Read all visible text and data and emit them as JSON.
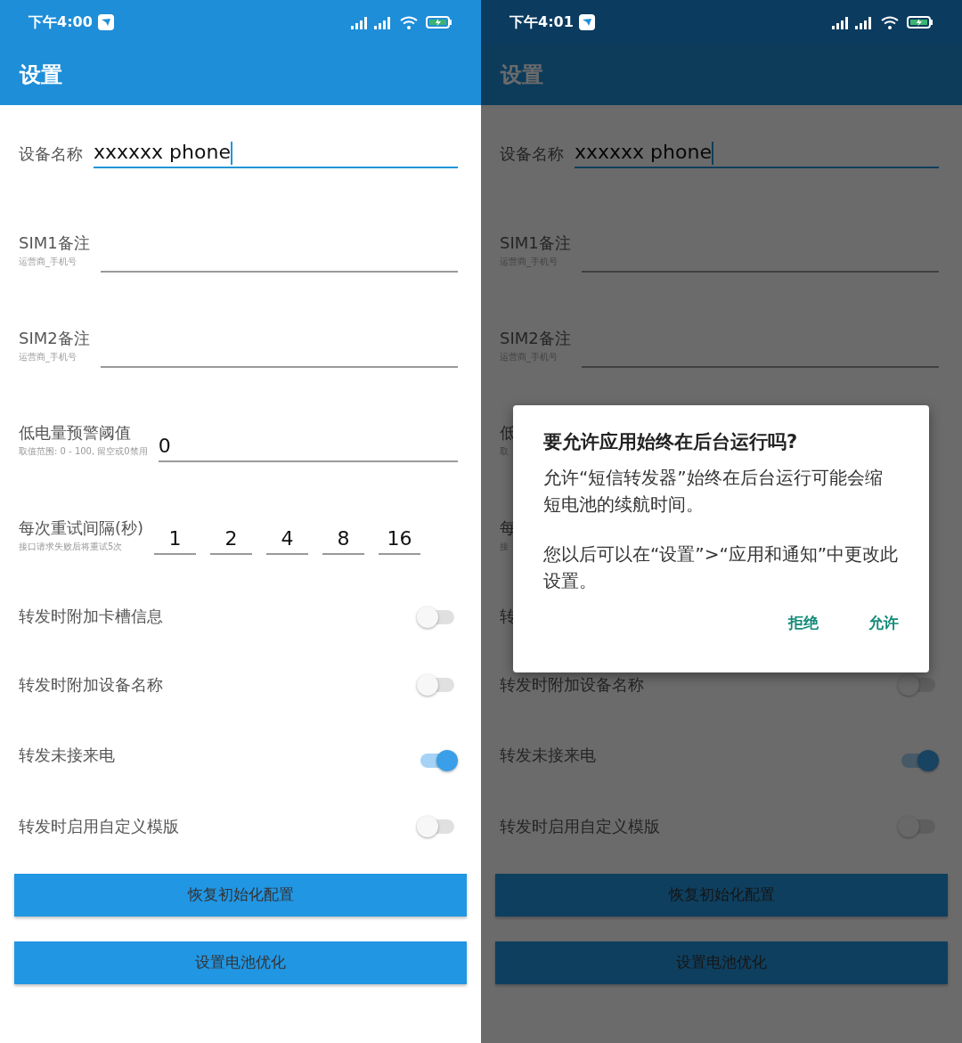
{
  "screens": [
    {
      "status_time": "下午4:00",
      "title": "设置",
      "dimmed": false,
      "rows": [
        {
          "kind": "text_field",
          "label": "设备名称",
          "value": "xxxxxx phone",
          "focused": true
        },
        {
          "kind": "text_field",
          "label": "SIM1备注",
          "hint": "运营商_手机号"
        },
        {
          "kind": "text_field",
          "label": "SIM2备注",
          "hint": "运营商_手机号"
        },
        {
          "kind": "text_field",
          "label": "低电量预警阈值",
          "hint": "取值范围: 0 - 100, 留空或0禁用",
          "value": "0"
        },
        {
          "kind": "retry",
          "label": "每次重试间隔(秒)",
          "hint": "接口请求失败后将重试5次",
          "values": [
            "1",
            "2",
            "4",
            "8",
            "16"
          ]
        },
        {
          "kind": "switch",
          "label": "转发时附加卡槽信息",
          "on": false
        },
        {
          "kind": "switch",
          "label": "转发时附加设备名称",
          "on": false
        },
        {
          "kind": "switch",
          "label": "转发未接来电",
          "on": true
        },
        {
          "kind": "switch",
          "label": "转发时启用自定义模版",
          "on": false
        }
      ],
      "buttons": [
        "恢复初始化配置",
        "设置电池优化"
      ]
    },
    {
      "status_time": "下午4:01",
      "title": "设置",
      "dimmed": true,
      "rows": [
        {
          "kind": "text_field",
          "label": "设备名称",
          "value": "xxxxxx phone",
          "focused": true
        },
        {
          "kind": "text_field",
          "label": "SIM1备注",
          "hint": "运营商_手机号"
        },
        {
          "kind": "text_field",
          "label": "SIM2备注",
          "hint": "运营商_手机号"
        },
        {
          "kind": "covered",
          "label": "低",
          "hint": "取"
        },
        {
          "kind": "covered",
          "label": "每",
          "hint": "接"
        },
        {
          "kind": "covered",
          "label": "转"
        },
        {
          "kind": "switch",
          "label": "转发时附加设备名称",
          "on": false
        },
        {
          "kind": "switch",
          "label": "转发未接来电",
          "on": true
        },
        {
          "kind": "switch",
          "label": "转发时启用自定义模版",
          "on": false
        }
      ],
      "buttons": [
        "恢复初始化配置",
        "设置电池优化"
      ],
      "dialog": {
        "title": "要允许应用始终在后台运行吗?",
        "paragraphs": [
          "允许“短信转发器”始终在后台运行可能会缩短电池的续航时间。",
          "您以后可以在“设置”>“应用和通知”中更改此设置。"
        ],
        "actions": [
          "拒绝",
          "允许"
        ]
      }
    }
  ]
}
